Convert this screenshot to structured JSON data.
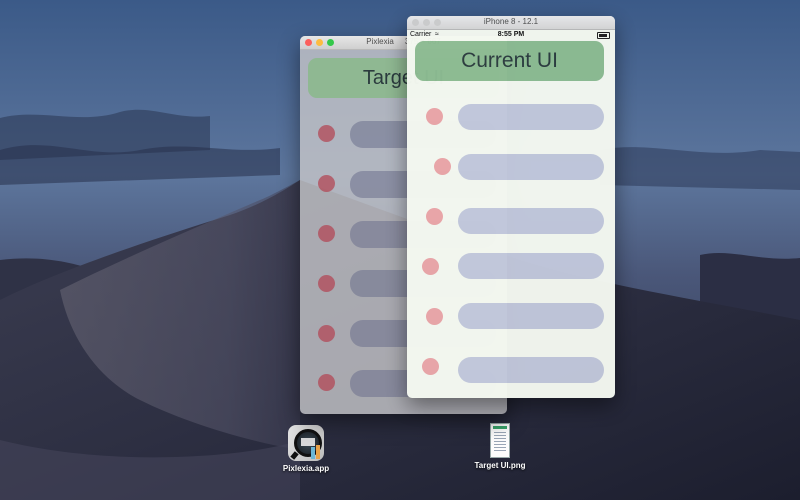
{
  "desktop": {
    "icons": [
      {
        "label": "Pixlexia.app",
        "icon": "pixlexia-app-icon"
      },
      {
        "label": "Target UI.png",
        "icon": "png-document-icon"
      }
    ]
  },
  "pixlexia_window": {
    "title": "Pixlexia     375 × 667",
    "heading": "Target UI",
    "rows": 6,
    "colors": {
      "heading_bg": "#8fb892",
      "dot": "#b24c5a",
      "pill": "#6c708c"
    }
  },
  "simulator_window": {
    "title": "iPhone 8 - 12.1",
    "status_bar": {
      "carrier": "Carrier",
      "time": "8:55 PM",
      "wifi_icon": "wifi-icon",
      "battery_icon": "battery-icon"
    },
    "heading": "Current UI",
    "rows": 6,
    "colors": {
      "heading_bg": "#8dbc92",
      "dot": "#e8969b",
      "pill": "#b8c0d8",
      "background": "#f5f9f1"
    }
  },
  "window_controls": {
    "close": "#fc605c",
    "minimize": "#fdbc40",
    "zoom": "#34c84a",
    "inactive": "#cfcfcf"
  }
}
